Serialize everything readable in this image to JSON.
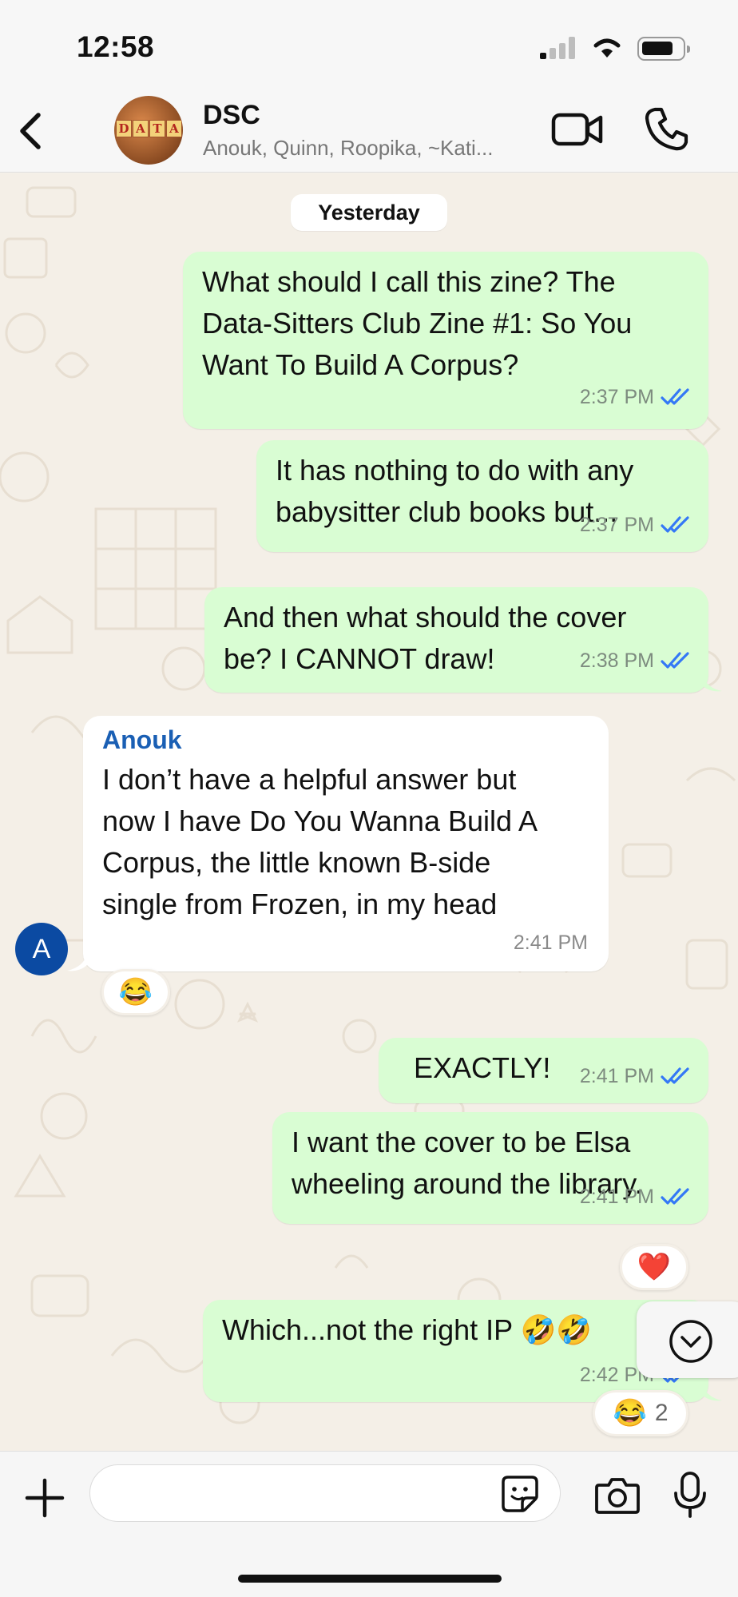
{
  "status_bar": {
    "time": "12:58"
  },
  "header": {
    "back_icon": "chevron-left-icon",
    "group_avatar_text": [
      "D",
      "A",
      "T",
      "A"
    ],
    "group_name": "DSC",
    "members": "Anouk, Quinn, Roopika, ~Kati...",
    "video_call_icon": "video-camera-icon",
    "voice_call_icon": "phone-icon"
  },
  "chat": {
    "date_label": "Yesterday",
    "messages": [
      {
        "direction": "out",
        "lines": [
          "What should I call this zine? The",
          "Data-Sitters Club Zine #1: So You",
          "Want To Build A Corpus?"
        ],
        "time": "2:37 PM",
        "status": "read"
      },
      {
        "direction": "out",
        "lines": [
          "It has nothing to do with any",
          "babysitter club books but..."
        ],
        "time": "2:37 PM",
        "status": "read"
      },
      {
        "direction": "out",
        "lines": [
          "And then what should the cover",
          "be? I CANNOT draw!"
        ],
        "time": "2:38 PM",
        "status": "read"
      },
      {
        "direction": "in",
        "sender": "Anouk",
        "avatar_letter": "A",
        "lines": [
          "I don’t have a helpful answer but",
          "now I have Do You Wanna Build A",
          "Corpus, the little known B-side",
          "single from Frozen, in my head"
        ],
        "time": "2:41 PM",
        "reaction": "😂"
      },
      {
        "direction": "out",
        "lines": [
          "EXACTLY!"
        ],
        "time": "2:41 PM",
        "status": "read"
      },
      {
        "direction": "out",
        "lines": [
          "I want the cover to be Elsa",
          "wheeling around the library."
        ],
        "time": "2:41 PM",
        "status": "read",
        "reaction": "❤️"
      },
      {
        "direction": "out",
        "lines": [
          "Which...not the right IP 🤣🤣"
        ],
        "time": "2:42 PM",
        "status": "read",
        "reaction": "😂",
        "reaction_count": "2"
      }
    ],
    "scroll_down_icon": "chevron-down-circle-icon"
  },
  "composer": {
    "plus_icon": "plus-icon",
    "input_value": "",
    "input_placeholder": "",
    "sticker_icon": "sticker-icon",
    "camera_icon": "camera-icon",
    "mic_icon": "microphone-icon"
  },
  "colors": {
    "outgoing_bubble": "#d9fdd3",
    "incoming_bubble": "#ffffff",
    "chat_background": "#f4efe7",
    "read_ticks": "#3478f6",
    "sender_name": "#1a5fb4",
    "avatar_a": "#0b4aa2"
  }
}
